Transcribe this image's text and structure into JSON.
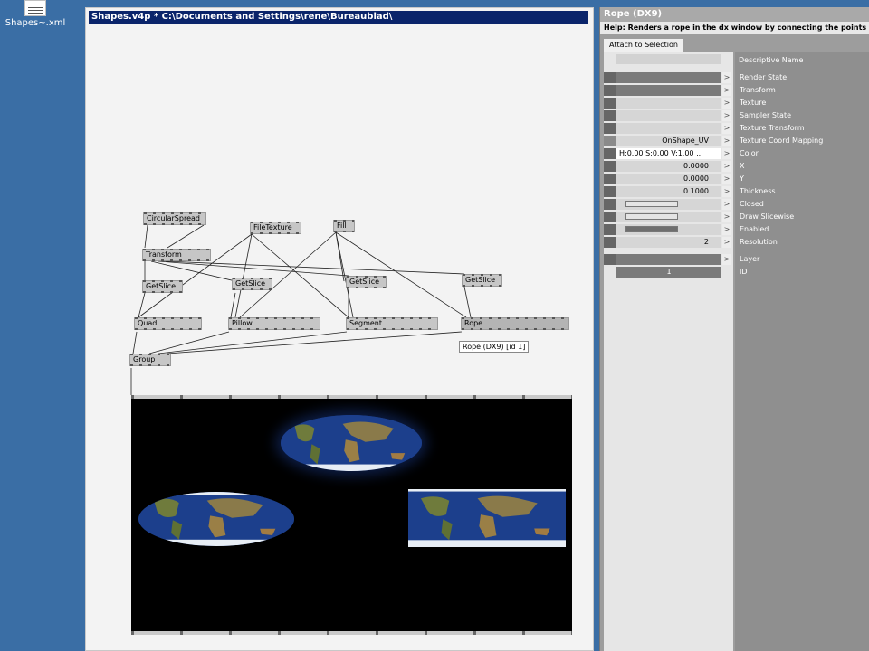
{
  "desktop": {
    "icon_label": "Shapes~.xml"
  },
  "patch": {
    "title": "Shapes.v4p *  C:\\Documents and Settings\\rene\\Bureaublad\\",
    "nodes": {
      "circular_spread": "CircularSpread",
      "transform": "Transform",
      "file_texture": "FileTexture",
      "fill": "Fill",
      "getslice_1": "GetSlice",
      "getslice_2": "GetSlice",
      "getslice_3": "GetSlice",
      "getslice_4": "GetSlice",
      "quad": "Quad",
      "pillow": "Pillow",
      "segment": "Segment",
      "rope": "Rope",
      "group": "Group"
    },
    "tooltip": "Rope (DX9) [id 1]"
  },
  "inspector": {
    "title": "Rope (DX9)",
    "help": "Help: Renders a rope in the dx window by connecting the points",
    "attach": "Attach to Selection",
    "header_right": "Descriptive Name",
    "rows": [
      {
        "name": "Render State",
        "value": ""
      },
      {
        "name": "Transform",
        "value": ""
      },
      {
        "name": "Texture",
        "value": ""
      },
      {
        "name": "Sampler State",
        "value": ""
      },
      {
        "name": "Texture Transform",
        "value": ""
      },
      {
        "name": "Texture Coord Mapping",
        "value": "OnShape_UV"
      },
      {
        "name": "Color",
        "value": "H:0.00  S:0.00  V:1.00  ..."
      },
      {
        "name": "X",
        "value": "0.0000"
      },
      {
        "name": "Y",
        "value": "0.0000"
      },
      {
        "name": "Thickness",
        "value": "0.1000"
      },
      {
        "name": "Closed",
        "value": ""
      },
      {
        "name": "Draw Slicewise",
        "value": ""
      },
      {
        "name": "Enabled",
        "value": ""
      },
      {
        "name": "Resolution",
        "value": "2"
      },
      {
        "name": "Layer",
        "value": ""
      },
      {
        "name": "ID",
        "value": "1"
      }
    ],
    "arrow_glyph": ">",
    "dropdown_glyph": "▼"
  }
}
